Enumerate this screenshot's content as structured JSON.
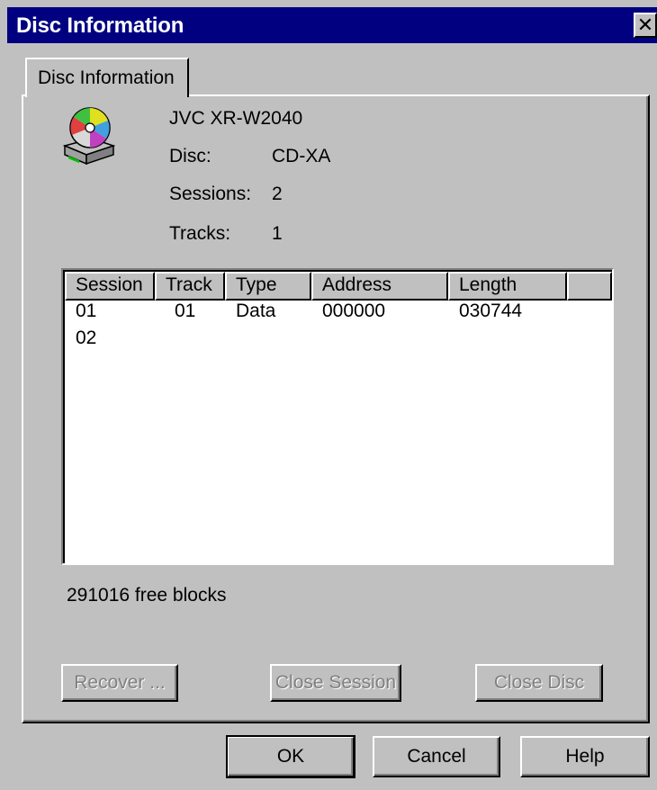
{
  "window": {
    "title": "Disc Information",
    "close_glyph": "✕"
  },
  "tab": {
    "label": "Disc Information"
  },
  "device": {
    "icon": "cd-drive-icon",
    "name": "JVC XR-W2040",
    "disc_label": "Disc:",
    "disc_value": "CD-XA",
    "sessions_label": "Sessions:",
    "sessions_value": "2",
    "tracks_label": "Tracks:",
    "tracks_value": "1"
  },
  "table": {
    "columns": [
      "Session",
      "Track",
      "Type",
      "Address",
      "Length"
    ],
    "rows": [
      {
        "session": "01",
        "track": "01",
        "type": "Data",
        "address": "000000",
        "length": "030744"
      },
      {
        "session": "02",
        "track": "",
        "type": "",
        "address": "",
        "length": ""
      }
    ]
  },
  "free_blocks": "291016 free blocks",
  "buttons": {
    "recover": "Recover ...",
    "close_session": "Close Session",
    "close_disc": "Close Disc",
    "ok": "OK",
    "cancel": "Cancel",
    "help": "Help"
  },
  "colors": {
    "titlebar": "#000080",
    "face": "#c0c0c0",
    "disabled_text": "#808080"
  }
}
